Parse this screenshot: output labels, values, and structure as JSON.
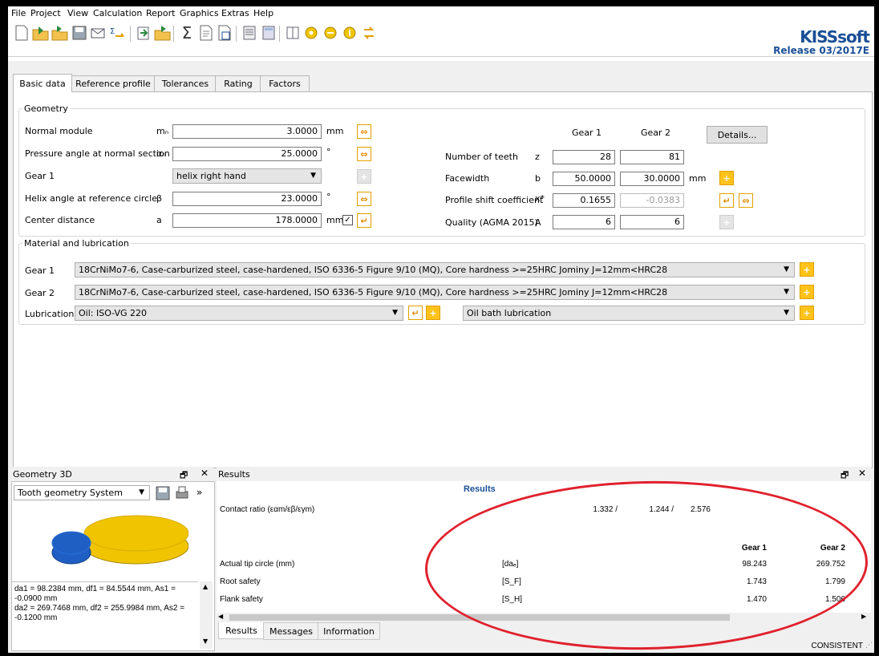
{
  "menu": [
    "File",
    "Project",
    "View",
    "Calculation",
    "Report",
    "Graphics",
    "Extras",
    "Help"
  ],
  "logo": "KISSsoft",
  "release": "Release 03/2017E",
  "tabs": [
    "Basic data",
    "Reference profile",
    "Tolerances",
    "Rating",
    "Factors"
  ],
  "geometry": {
    "title": "Geometry",
    "normal_module": {
      "label": "Normal module",
      "symbol": "mₙ",
      "value": "3.0000",
      "unit": "mm"
    },
    "pressure_angle": {
      "label": "Pressure angle at normal section",
      "symbol": "αₙ",
      "value": "25.0000",
      "unit": "°"
    },
    "gear1": {
      "label": "Gear 1",
      "value": "helix right hand"
    },
    "helix_angle": {
      "label": "Helix angle at reference circle",
      "symbol": "β",
      "value": "23.0000",
      "unit": "°"
    },
    "center_distance": {
      "label": "Center distance",
      "symbol": "a",
      "value": "178.0000",
      "unit": "mm"
    },
    "col_gear1": "Gear 1",
    "col_gear2": "Gear 2",
    "details_button": "Details...",
    "teeth": {
      "label": "Number of teeth",
      "symbol": "z",
      "g1": "28",
      "g2": "81"
    },
    "facewidth": {
      "label": "Facewidth",
      "symbol": "b",
      "g1": "50.0000",
      "g2": "30.0000",
      "unit": "mm"
    },
    "profile_shift": {
      "label": "Profile shift coefficient",
      "symbol": "x*",
      "g1": "0.1655",
      "g2": "-0.0383"
    },
    "quality": {
      "label": "Quality (AGMA 2015)",
      "symbol": "A",
      "g1": "6",
      "g2": "6"
    }
  },
  "material": {
    "title": "Material and lubrication",
    "gear1_label": "Gear 1",
    "gear1_value": "18CrNiMo7-6, Case-carburized steel, case-hardened, ISO 6336-5 Figure 9/10 (MQ), Core hardness >=25HRC Jominy J=12mm<HRC28",
    "gear2_label": "Gear 2",
    "gear2_value": "18CrNiMo7-6, Case-carburized steel, case-hardened, ISO 6336-5 Figure 9/10 (MQ), Core hardness >=25HRC Jominy J=12mm<HRC28",
    "lubrication_label": "Lubrication",
    "lubrication_value": "Oil: ISO-VG 220",
    "lubrication_type": "Oil bath lubrication"
  },
  "geometry3d": {
    "title": "Geometry 3D",
    "combo": "Tooth geometry System",
    "info": "da1 = 98.2384 mm, df1 = 84.5544 mm, As1 = -0.0900 mm\nda2 = 269.7468 mm, df2 = 255.9984 mm, As2 = -0.1200 mm",
    "colors": {
      "gear_small": "#1f5fc4",
      "gear_large": "#f1c400"
    }
  },
  "results": {
    "pane_title": "Results",
    "heading": "Results",
    "contact_ratio_label": "Contact ratio (εαm/εβ/εγm)",
    "contact_ratio_values": [
      "1.332 /",
      "1.244 /",
      "2.576"
    ],
    "col_gear1": "Gear 1",
    "col_gear2": "Gear 2",
    "rows": [
      {
        "label": "Actual tip circle (mm)",
        "symbol": "[daₑ]",
        "g1": "98.243",
        "g2": "269.752"
      },
      {
        "label": "Root safety",
        "symbol": "[S_F]",
        "g1": "1.743",
        "g2": "1.799"
      },
      {
        "label": "Flank safety",
        "symbol": "[S_H]",
        "g1": "1.470",
        "g2": "1.506"
      }
    ],
    "bottom_tabs": [
      "Results",
      "Messages",
      "Information"
    ]
  },
  "status": "CONSISTENT",
  "accent_color": "#1a4f96",
  "annotation_color": "#e0212d"
}
